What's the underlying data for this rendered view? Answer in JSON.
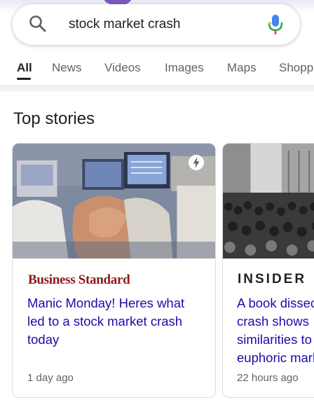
{
  "search": {
    "query": "stock market crash"
  },
  "tabs": [
    {
      "label": "All",
      "active": true
    },
    {
      "label": "News",
      "active": false
    },
    {
      "label": "Videos",
      "active": false
    },
    {
      "label": "Images",
      "active": false
    },
    {
      "label": "Maps",
      "active": false
    },
    {
      "label": "Shopping",
      "active": false
    }
  ],
  "top_stories": {
    "title": "Top stories",
    "cards": [
      {
        "source": "Business Standard",
        "headline_lines": [
          "Manic Monday! Heres what",
          "led to a stock market crash",
          "today"
        ],
        "time": "1 day ago",
        "amp_icon": "lightning-bolt-icon"
      },
      {
        "source": "INSIDER",
        "headline_lines": [
          "A book dissecting the",
          "crash shows",
          "similarities to",
          "euphoric markets"
        ],
        "time": "22 hours ago"
      }
    ]
  },
  "colors": {
    "link": "#1a0dab",
    "business_standard": "#8b1a1a",
    "muted": "#5f6368"
  }
}
